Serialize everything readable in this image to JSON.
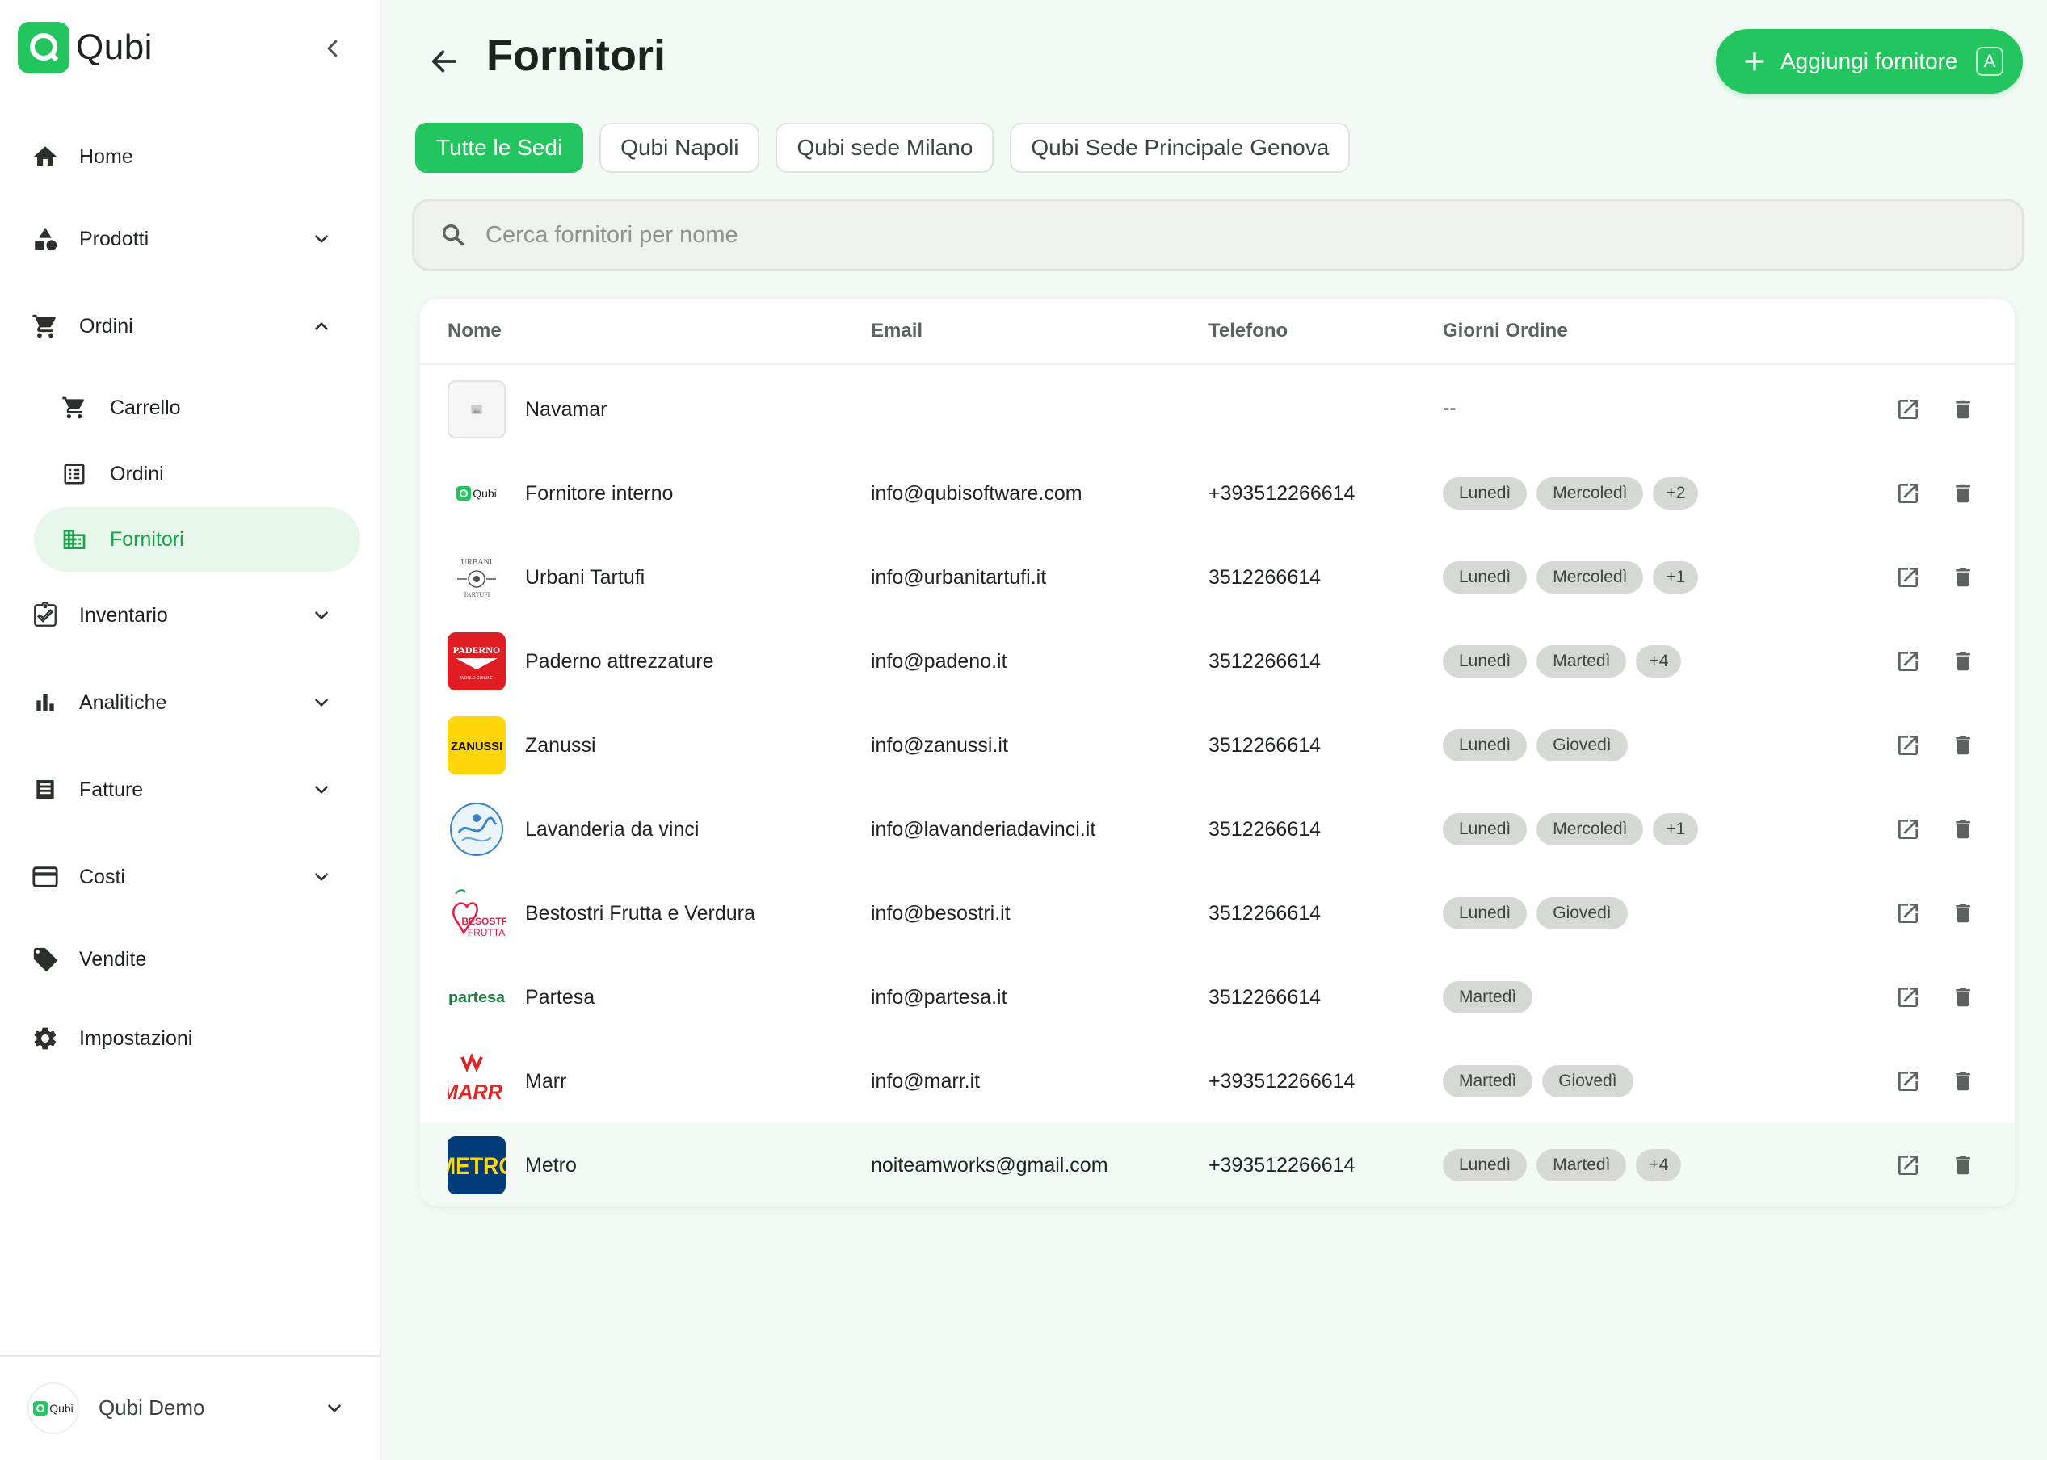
{
  "app": {
    "brand": "Qubi",
    "org_name": "Qubi Demo"
  },
  "sidebar": {
    "items": [
      {
        "label": "Home"
      },
      {
        "label": "Prodotti"
      },
      {
        "label": "Ordini"
      },
      {
        "label": "Inventario"
      },
      {
        "label": "Analitiche"
      },
      {
        "label": "Fatture"
      },
      {
        "label": "Costi"
      },
      {
        "label": "Vendite"
      },
      {
        "label": "Impostazioni"
      }
    ],
    "ordini_subitems": [
      {
        "label": "Carrello"
      },
      {
        "label": "Ordini"
      },
      {
        "label": "Fornitori",
        "active": true
      }
    ]
  },
  "header": {
    "title": "Fornitori",
    "add_button": "Aggiungi fornitore",
    "add_shortcut": "A"
  },
  "tabs": [
    {
      "label": "Tutte le Sedi",
      "active": true
    },
    {
      "label": "Qubi Napoli"
    },
    {
      "label": "Qubi sede Milano"
    },
    {
      "label": "Qubi Sede Principale Genova"
    }
  ],
  "search": {
    "placeholder": "Cerca fornitori per nome",
    "value": ""
  },
  "table": {
    "columns": [
      "Nome",
      "Email",
      "Telefono",
      "Giorni Ordine"
    ],
    "rows": [
      {
        "name": "Navamar",
        "email": "",
        "phone": "",
        "days": [],
        "days_empty": "--",
        "logo": "placeholder-image"
      },
      {
        "name": "Fornitore interno",
        "email": "info@qubisoftware.com",
        "phone": "+393512266614",
        "days": [
          "Lunedì",
          "Mercoledì"
        ],
        "more": "+2",
        "logo": "qubi-logo"
      },
      {
        "name": "Urbani Tartufi",
        "email": "info@urbanitartufi.it",
        "phone": "3512266614",
        "days": [
          "Lunedì",
          "Mercoledì"
        ],
        "more": "+1",
        "logo": "urbani-logo"
      },
      {
        "name": "Paderno attrezzature",
        "email": "info@padeno.it",
        "phone": "3512266614",
        "days": [
          "Lunedì",
          "Martedì"
        ],
        "more": "+4",
        "logo": "paderno-logo"
      },
      {
        "name": "Zanussi",
        "email": "info@zanussi.it",
        "phone": "3512266614",
        "days": [
          "Lunedì",
          "Giovedì"
        ],
        "more": "",
        "logo": "zanussi-logo"
      },
      {
        "name": "Lavanderia da vinci",
        "email": "info@lavanderiadavinci.it",
        "phone": "3512266614",
        "days": [
          "Lunedì",
          "Mercoledì"
        ],
        "more": "+1",
        "logo": "lavanderia-logo"
      },
      {
        "name": "Bestostri Frutta e Verdura",
        "email": "info@besostri.it",
        "phone": "3512266614",
        "days": [
          "Lunedì",
          "Giovedì"
        ],
        "more": "",
        "logo": "besostri-logo"
      },
      {
        "name": "Partesa",
        "email": "info@partesa.it",
        "phone": "3512266614",
        "days": [
          "Martedì"
        ],
        "more": "",
        "logo": "partesa-logo"
      },
      {
        "name": "Marr",
        "email": "info@marr.it",
        "phone": "+393512266614",
        "days": [
          "Martedì",
          "Giovedì"
        ],
        "more": "",
        "logo": "marr-logo"
      },
      {
        "name": "Metro",
        "email": "noiteamworks@gmail.com",
        "phone": "+393512266614",
        "days": [
          "Lunedì",
          "Martedì"
        ],
        "more": "+4",
        "logo": "metro-logo",
        "highlighted": true
      }
    ]
  },
  "logo_text": {
    "qubi": "Qubi",
    "urbani": [
      "URBANI",
      "TARTUFI"
    ],
    "paderno": [
      "PADERNO",
      "WORLD CUISINE"
    ],
    "zanussi": "ZANUSSI",
    "besostri": [
      "BESOSTRI",
      "FRUTTA"
    ],
    "partesa": "partesa",
    "marr": "MARR",
    "metro": "METRO"
  },
  "colors": {
    "accent": "#22c55e",
    "accent_soft": "#e6f6ea",
    "chip": "#d6d8d6"
  }
}
